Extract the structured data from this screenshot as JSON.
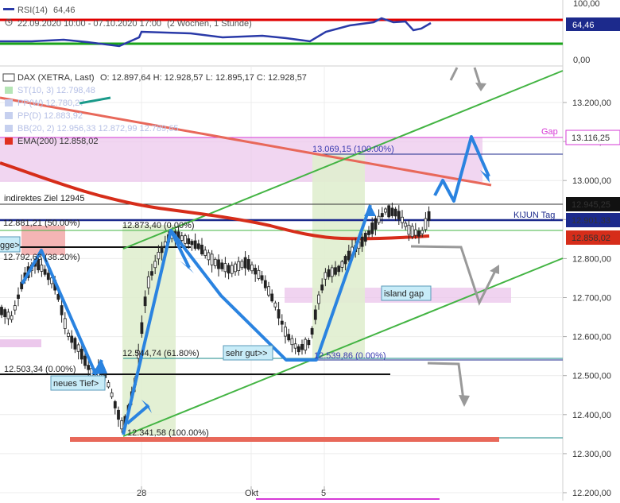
{
  "colors": {
    "up_candle": "#ffffff",
    "down_candle": "#222222",
    "rsi_line": "#2a3aa8",
    "rsi_upper": "#e00000",
    "rsi_lower": "#1aa31a",
    "ema200": "#d62d1a",
    "kijun": "#1c2a8c",
    "gap_line": "#d63ad6",
    "gap_zone": "#ecc8ec",
    "green_zone": "#e0eecf",
    "arrow_blue": "#2a83e0",
    "arrow_grey": "#999999",
    "channel_green": "#43b443",
    "trend_red": "#e8685a",
    "callout_bg": "#c8ecf8",
    "price_badge": "#1c2a8c"
  },
  "rsi_panel": {
    "legend_label": "RSI(14)",
    "legend_value": "64,46",
    "period_text": "22.09.2020 10:00 - 07.10.2020 17:00",
    "period_detail": "(2 Wochen, 1 Stunde)",
    "axis_ticks": [
      "100,00",
      "0,00"
    ],
    "current_value": "64,46"
  },
  "price_panel": {
    "title": "DAX (XETRA, Last)",
    "ohlc": "O: 12.897,64  H: 12.928,57  L: 12.895,17  C: 12.928,57",
    "legend_items": [
      {
        "label": "ST(10, 3)",
        "value": "12.798,48",
        "color": "#b6e6b6"
      },
      {
        "label": "PP(W)",
        "value": "12.780,27",
        "color": "#c6d0ef"
      },
      {
        "label": "PP(D)",
        "value": "12.883,92",
        "color": "#c6d0ef"
      },
      {
        "label": "BB(20, 2)",
        "value": "12.956,33",
        "value2": "12.872,99",
        "value3": "12.789,65",
        "color": "#c6d0ef"
      },
      {
        "label": "EMA(200)",
        "value": "12.858,02",
        "color": "#e03020"
      }
    ],
    "y_ticks": [
      "13.200,00",
      "13.100,00",
      "13.000,00",
      "12.900,00",
      "12.800,00",
      "12.700,00",
      "12.600,00",
      "12.500,00",
      "12.400,00",
      "12.300,00",
      "12.200,00"
    ],
    "x_ticks": [
      "28",
      "Okt",
      "5"
    ],
    "price_badges": [
      {
        "text": "13.116,25",
        "kind": "gap"
      },
      {
        "text": "12.945,25",
        "kind": "close"
      },
      {
        "text": "12.901,33",
        "kind": "kijun"
      },
      {
        "text": "12.858,02",
        "kind": "ema"
      }
    ]
  },
  "annotations": {
    "gap_label": "Gap",
    "kijun_label": "KIJUN Tag",
    "target_text": "indirektes Ziel 12945",
    "fib_100_top": "13.069,15 (100.00%)",
    "fib_50": "12.881,21 (50.00%)",
    "fib_0_top": "12.873,40 (0.00%)",
    "fib_38": "12.792,63 (38.20%)",
    "fib_618": "12.544,74 (61.80%)",
    "fib_0_mid": "12.539,86 (0.00%)",
    "fib_0_low": "12.503,34 (0.00%)",
    "fib_100_low": "12.341,58 (100.00%)",
    "callout_left": "gge>",
    "callout_new_low": "neues Tief>",
    "callout_good": "sehr gut>>",
    "callout_island": "island gap"
  },
  "chart_data": {
    "type": "line",
    "series": [
      {
        "name": "DAX (XETRA, Last)",
        "points": [
          {
            "x": "22.09.2020",
            "y": 12640
          },
          {
            "x": "23.09.2020",
            "y": 12650
          },
          {
            "x": "24.09.2020",
            "y": 12540
          },
          {
            "x": "25.09.2020",
            "y": 12380
          },
          {
            "x": "28.09.2020",
            "y": 12850
          },
          {
            "x": "29.09.2020",
            "y": 12790
          },
          {
            "x": "30.09.2020",
            "y": 12760
          },
          {
            "x": "01.10.2020",
            "y": 12730
          },
          {
            "x": "02.10.2020",
            "y": 12560
          },
          {
            "x": "05.10.2020",
            "y": 12740
          },
          {
            "x": "06.10.2020",
            "y": 12920
          },
          {
            "x": "07.10.2020",
            "y": 12928.57
          }
        ]
      },
      {
        "name": "EMA(200)",
        "last": 12858.02
      },
      {
        "name": "RSI(14)",
        "last": 64.46
      }
    ],
    "levels": {
      "gap": 13116.25,
      "target": 12945,
      "kijun": 12901.33,
      "ema200": 12858.02
    },
    "ylim": [
      12200,
      13300
    ],
    "rsi_ylim": [
      0,
      100
    ],
    "grid": true,
    "legend": "top-left"
  }
}
